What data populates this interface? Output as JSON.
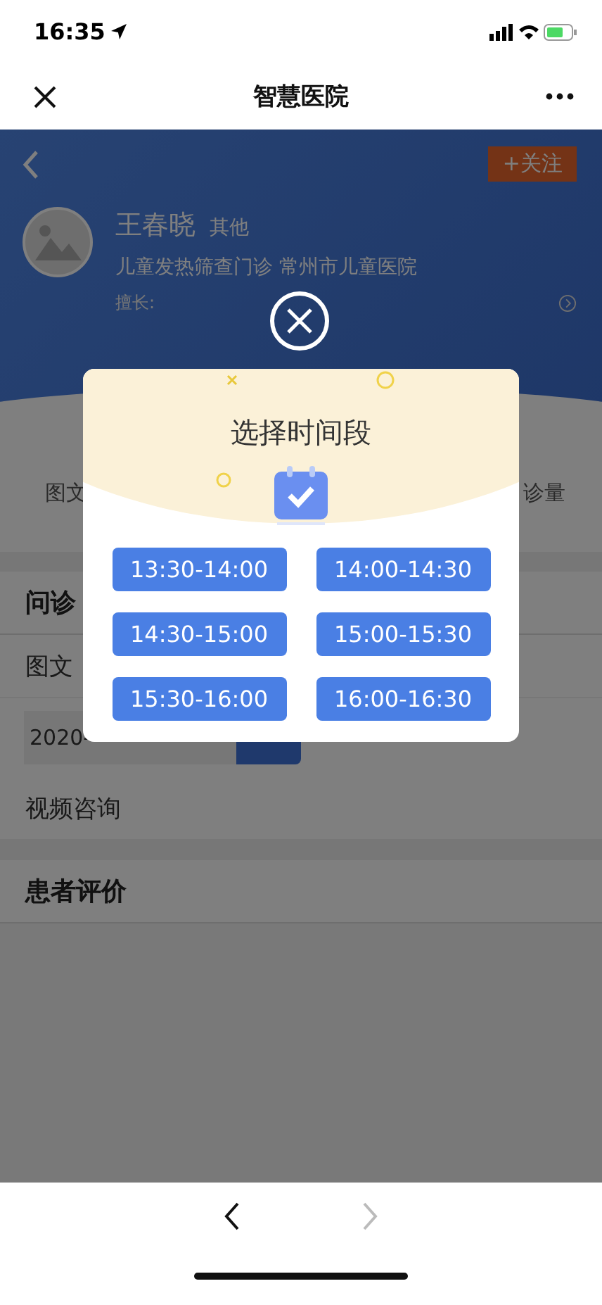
{
  "status_bar": {
    "time": "16:35"
  },
  "nav_bar": {
    "title": "智慧医院"
  },
  "doctor": {
    "name": "王春晓",
    "title": "其他",
    "department": "儿童发热筛查门诊 常州市儿童医院",
    "specialty_label": "擅长:",
    "follow_button": "+关注"
  },
  "stats": {
    "left_label": "图文",
    "right_label": "诊量"
  },
  "sections": [
    {
      "kind": "heading",
      "text": "问诊"
    },
    {
      "kind": "row",
      "text": "图文"
    },
    {
      "kind": "date",
      "text": "2020-"
    },
    {
      "kind": "row",
      "text": "视频咨询"
    },
    {
      "kind": "gap"
    },
    {
      "kind": "heading",
      "text": "患者评价"
    }
  ],
  "modal": {
    "title": "选择时间段",
    "slots": [
      "13:30-14:00",
      "14:00-14:30",
      "14:30-15:00",
      "15:00-15:30",
      "15:30-16:00",
      "16:00-16:30"
    ]
  }
}
